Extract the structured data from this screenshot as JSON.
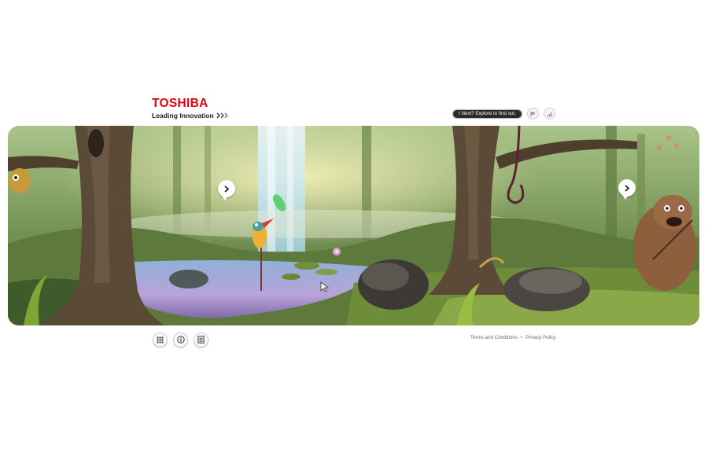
{
  "header": {
    "brand": "TOSHIBA",
    "tagline": "Leading Innovation",
    "brand_color": "#e60012"
  },
  "top_bar": {
    "prompt_text": "t Next? Explore to find out.",
    "buttons": [
      {
        "icon": "flag-icon"
      },
      {
        "icon": "signal-bars-icon"
      }
    ]
  },
  "scene": {
    "left_arrow_icon": "chevron-right-icon",
    "right_arrow_icon": "chevron-right-icon"
  },
  "toolbar": {
    "buttons": [
      {
        "icon": "grid-icon"
      },
      {
        "icon": "info-icon"
      },
      {
        "icon": "document-icon"
      }
    ]
  },
  "footer": {
    "terms": "Terms and Conditions",
    "separator": "•",
    "privacy": "Privacy Policy"
  }
}
